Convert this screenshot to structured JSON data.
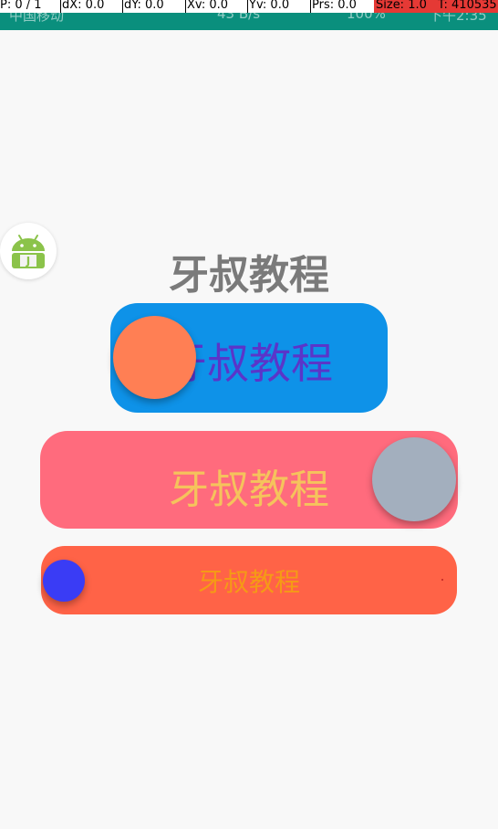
{
  "status_bar": {
    "carrier": "中国移动",
    "net_speed": "43 B/s",
    "battery": "100%",
    "time": "下午2:35"
  },
  "pointer_overlay": {
    "p": "P: 0 / 1",
    "dx": "dX: 0.0",
    "dy": "dY: 0.0",
    "xv": "Xv: 0.0",
    "yv": "Yv: 0.0",
    "prs": "Prs: 0.0",
    "size": "Size: 1.0",
    "t": "T: 410535"
  },
  "floating_icon": "android-icon",
  "main": {
    "title": "牙叔教程",
    "switches": [
      {
        "label": "牙叔教程",
        "checked": false,
        "track_color": "#0e92e8",
        "thumb_color": "#ff7f54",
        "text_color": "#5a35c9"
      },
      {
        "label": "牙叔教程",
        "checked": true,
        "track_color": "#ff6b7d",
        "thumb_color": "#a3afbe",
        "text_color": "#f5c35c"
      },
      {
        "label": "牙叔教程",
        "checked": false,
        "track_color": "#ff6347",
        "thumb_color": "#3a3cf5",
        "text_color": "#f59a16"
      }
    ]
  }
}
